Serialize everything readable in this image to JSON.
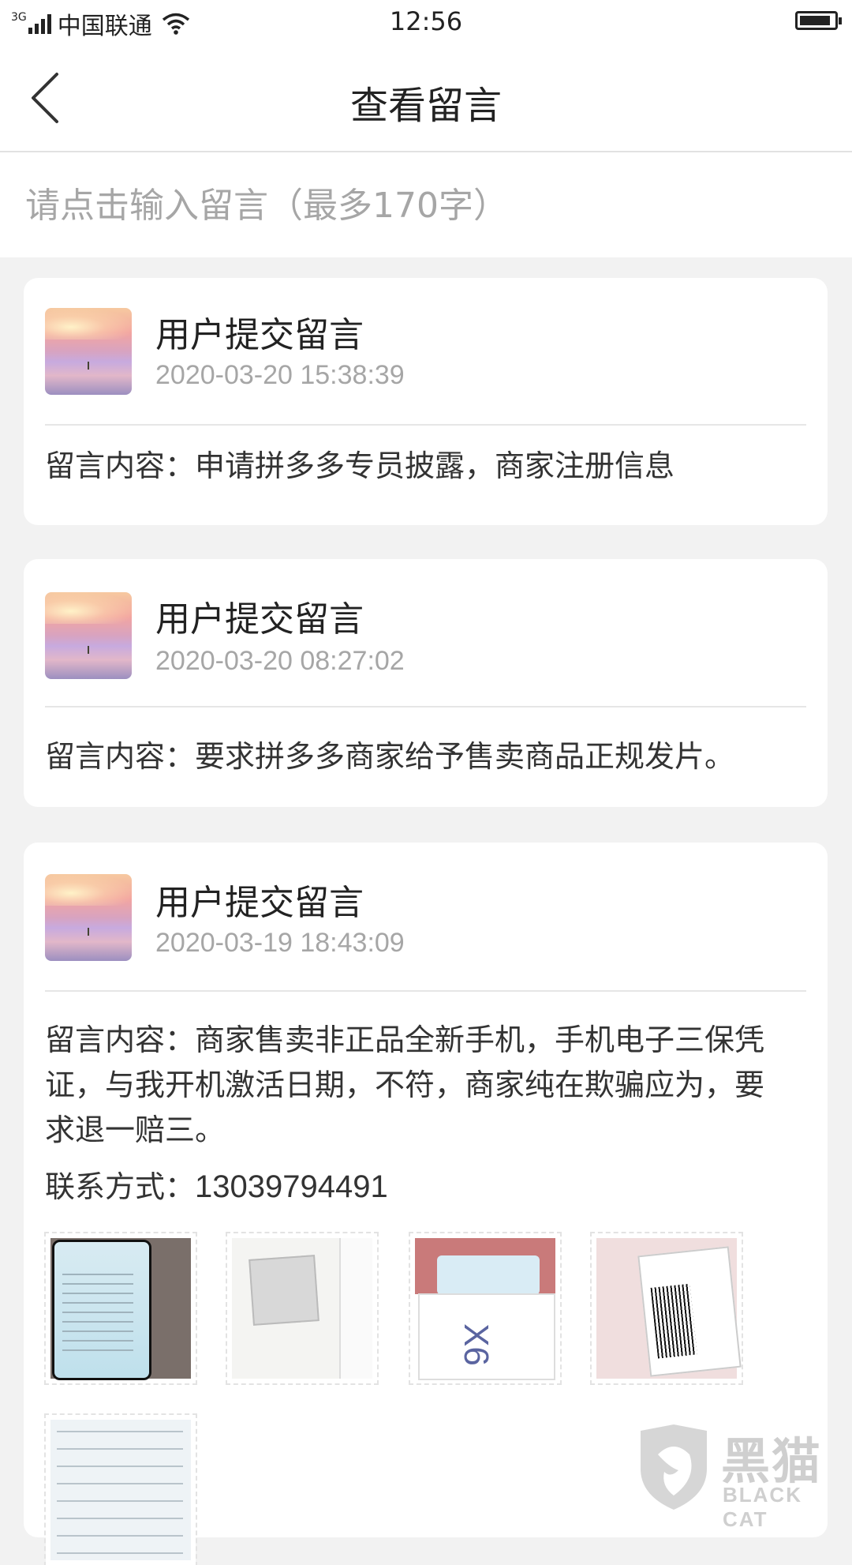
{
  "status_bar": {
    "network_type": "3G",
    "carrier": "中国联通",
    "time": "12:56"
  },
  "nav": {
    "title": "查看留言"
  },
  "message_input": {
    "placeholder": "请点击输入留言（最多170字）"
  },
  "messages": [
    {
      "title": "用户提交留言",
      "time": "2020-03-20 15:38:39",
      "content": "留言内容：申请拼多多专员披露，商家注册信息"
    },
    {
      "title": "用户提交留言",
      "time": "2020-03-20 08:27:02",
      "content": "留言内容：要求拼多多商家给予售卖商品正规发片。"
    },
    {
      "title": "用户提交留言",
      "time": "2020-03-19 18:43:09",
      "content": "留言内容：商家售卖非正品全新手机，手机电子三保凭证，与我开机激活日期，不符，商家纯在欺骗应为，要求退一赔三。",
      "contact_label": "联系方式：",
      "contact_value": "13039794491"
    }
  ],
  "watermark": {
    "logo_text": "黑猫",
    "logo_sub": "BLACK CAT"
  }
}
